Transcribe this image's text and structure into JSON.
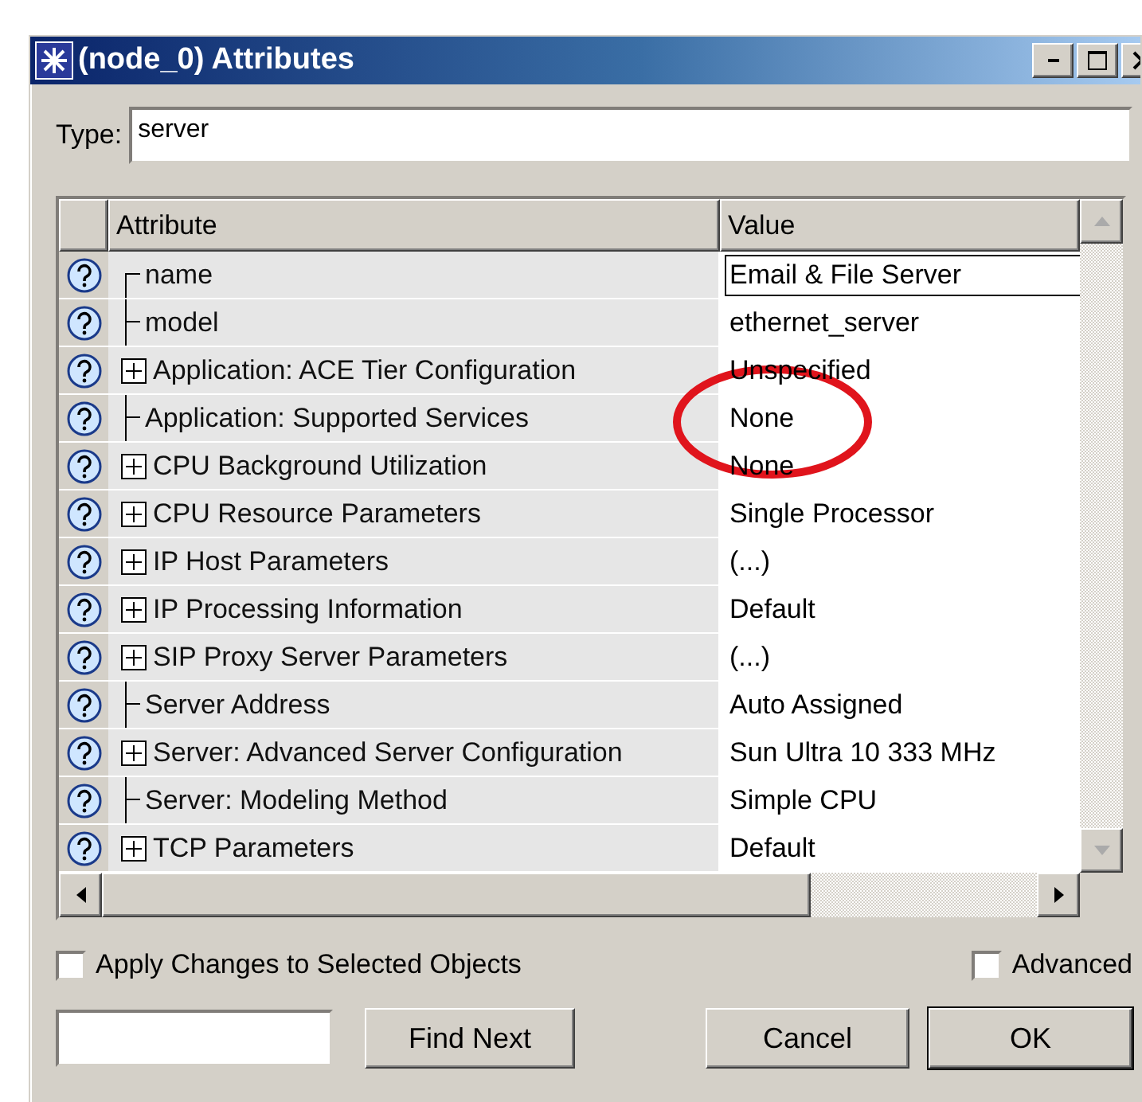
{
  "window": {
    "title": "(node_0) Attributes"
  },
  "type_field": {
    "label": "Type:",
    "value": "server"
  },
  "table": {
    "columns": [
      "Attribute",
      "Value"
    ],
    "rows": [
      {
        "kind": "first",
        "attribute": "name",
        "value": "Email & File Server",
        "editing": true
      },
      {
        "kind": "leaf",
        "attribute": "model",
        "value": "ethernet_server",
        "editing": false
      },
      {
        "kind": "group",
        "attribute": "Application: ACE Tier Configuration",
        "value": "Unspecified",
        "editing": false
      },
      {
        "kind": "leaf",
        "attribute": "Application: Supported Services",
        "value": "None",
        "editing": false
      },
      {
        "kind": "group",
        "attribute": "CPU Background Utilization",
        "value": "None",
        "editing": false
      },
      {
        "kind": "group",
        "attribute": "CPU Resource Parameters",
        "value": "Single Processor",
        "editing": false
      },
      {
        "kind": "group",
        "attribute": "IP Host Parameters",
        "value": "(...)",
        "editing": false
      },
      {
        "kind": "group",
        "attribute": "IP Processing Information",
        "value": "Default",
        "editing": false
      },
      {
        "kind": "group",
        "attribute": "SIP Proxy Server Parameters",
        "value": "(...)",
        "editing": false
      },
      {
        "kind": "leaf",
        "attribute": "Server Address",
        "value": "Auto Assigned",
        "editing": false
      },
      {
        "kind": "group",
        "attribute": "Server: Advanced Server Configuration",
        "value": "Sun Ultra 10 333 MHz",
        "editing": false
      },
      {
        "kind": "leaf",
        "attribute": "Server: Modeling Method",
        "value": "Simple CPU",
        "editing": false
      },
      {
        "kind": "group",
        "attribute": "TCP Parameters",
        "value": "Default",
        "editing": false
      }
    ],
    "annotations": [
      {
        "kind": "ellipse"
      }
    ]
  },
  "options": [
    {
      "label": "Apply Changes to Selected Objects",
      "checked": false
    },
    {
      "label": "Advanced",
      "checked": false
    }
  ],
  "buttons": [
    {
      "label": "Find Next",
      "default": false
    },
    {
      "label": "Cancel",
      "default": false
    },
    {
      "label": "OK",
      "default": true
    }
  ]
}
